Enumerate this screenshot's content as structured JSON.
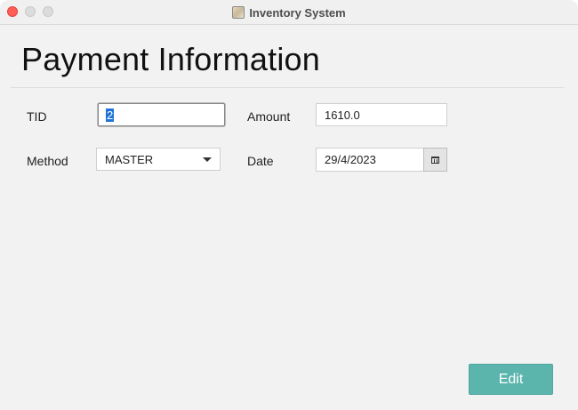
{
  "window": {
    "title": "Inventory System",
    "app_icon": "inventory-app-icon"
  },
  "page": {
    "heading": "Payment Information"
  },
  "form": {
    "tid_label": "TID",
    "tid_value": "2",
    "amount_label": "Amount",
    "amount_value": "1610.0",
    "method_label": "Method",
    "method_value": "MASTER",
    "date_label": "Date",
    "date_value": "29/4/2023"
  },
  "actions": {
    "edit_label": "Edit"
  },
  "colors": {
    "accent": "#5bb5ad",
    "selection": "#1f73d9",
    "close": "#ff5f57"
  }
}
